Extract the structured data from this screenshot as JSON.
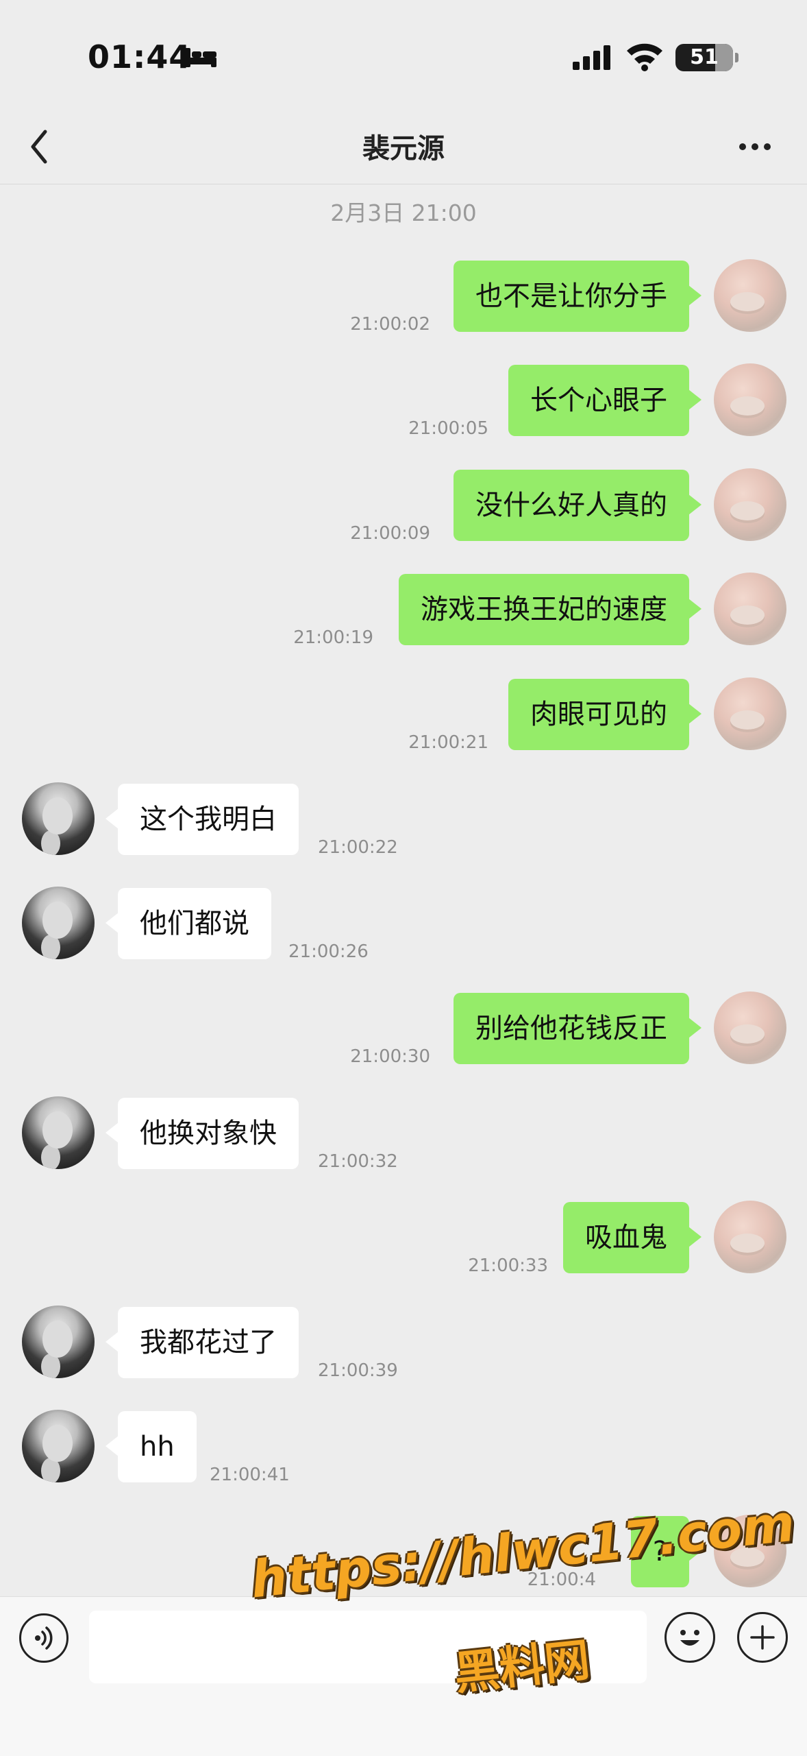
{
  "status_bar": {
    "time": "01:44",
    "battery": "51",
    "icons": [
      "bed-icon",
      "signal-icon",
      "wifi-icon",
      "battery-icon"
    ]
  },
  "nav": {
    "title": "裴元源",
    "back_icon": "chevron-left-icon",
    "more_icon": "more-icon"
  },
  "date_separator": "2月3日 21:00",
  "messages": [
    {
      "from": "me",
      "text": "也不是让你分手",
      "time": "21:00:02"
    },
    {
      "from": "me",
      "text": "长个心眼子",
      "time": "21:00:05"
    },
    {
      "from": "me",
      "text": "没什么好人真的",
      "time": "21:00:09"
    },
    {
      "from": "me",
      "text": "游戏王换王妃的速度",
      "time": "21:00:19"
    },
    {
      "from": "me",
      "text": "肉眼可见的",
      "time": "21:00:21"
    },
    {
      "from": "them",
      "text": "这个我明白",
      "time": "21:00:22"
    },
    {
      "from": "them",
      "text": "他们都说",
      "time": "21:00:26"
    },
    {
      "from": "me",
      "text": "别给他花钱反正",
      "time": "21:00:30"
    },
    {
      "from": "them",
      "text": "他换对象快",
      "time": "21:00:32"
    },
    {
      "from": "me",
      "text": "吸血鬼",
      "time": "21:00:33"
    },
    {
      "from": "them",
      "text": "我都花过了",
      "time": "21:00:39"
    },
    {
      "from": "them",
      "text": "hh",
      "time": "21:00:41"
    },
    {
      "from": "me",
      "text": "?",
      "time": "21:00:4"
    }
  ],
  "input_bar": {
    "voice_icon": "voice-icon",
    "emoji_icon": "emoji-icon",
    "plus_icon": "plus-icon",
    "input_value": ""
  },
  "watermark": {
    "url": "https://hlwc17.com",
    "name": "黑料网"
  },
  "colors": {
    "background": "#ededed",
    "bubble_me": "#95ec69",
    "bubble_them": "#ffffff",
    "timestamp": "#8d8d8d",
    "watermark": "#f5a623"
  }
}
